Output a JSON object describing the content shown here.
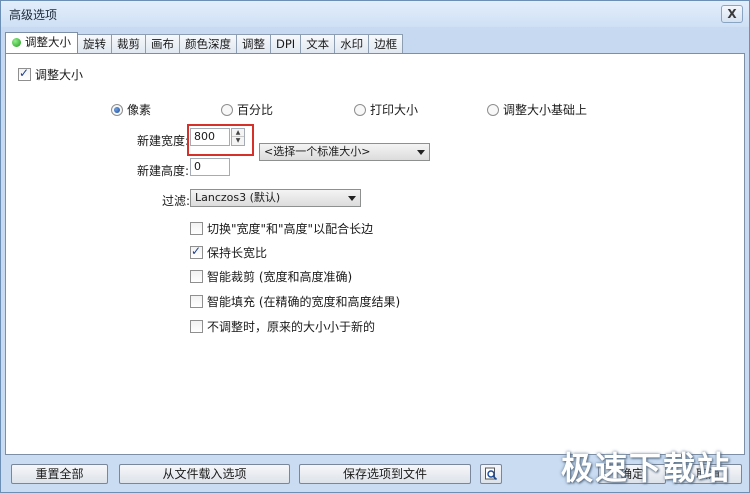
{
  "window": {
    "title": "高级选项",
    "close_glyph": "X"
  },
  "tabs": [
    {
      "label": "调整大小",
      "active": true
    },
    {
      "label": "旋转"
    },
    {
      "label": "裁剪"
    },
    {
      "label": "画布"
    },
    {
      "label": "颜色深度"
    },
    {
      "label": "调整"
    },
    {
      "label": "DPI"
    },
    {
      "label": "文本"
    },
    {
      "label": "水印"
    },
    {
      "label": "边框"
    }
  ],
  "resize": {
    "enable_label": "调整大小",
    "enable_checked": true,
    "modes": [
      {
        "label": "像素",
        "selected": true
      },
      {
        "label": "百分比"
      },
      {
        "label": "打印大小"
      },
      {
        "label": "调整大小基础上"
      }
    ],
    "width_label": "新建宽度:",
    "width_value": "800",
    "height_label": "新建高度:",
    "height_value": "0",
    "standard_size": "<选择一个标准大小>",
    "filter_label": "过滤:",
    "filter_value": "Lanczos3 (默认)",
    "options": [
      {
        "label": "切换\"宽度\"和\"高度\"以配合长边",
        "checked": false
      },
      {
        "label": "保持长宽比",
        "checked": true
      },
      {
        "label": "智能裁剪 (宽度和高度准确)",
        "checked": false
      },
      {
        "label": "智能填充 (在精确的宽度和高度结果)",
        "checked": false
      },
      {
        "label": "不调整时，原来的大小小于新的",
        "checked": false
      }
    ]
  },
  "footer": {
    "reset_all": "重置全部",
    "load_from_file": "从文件载入选项",
    "save_to_file": "保存选项到文件",
    "ok": "确定",
    "cancel": "取消"
  },
  "watermark": "极速下载站",
  "colors": {
    "accent": "#d6302b",
    "active_dot": "#1e9a1a",
    "frame": "#c9dcf2"
  }
}
